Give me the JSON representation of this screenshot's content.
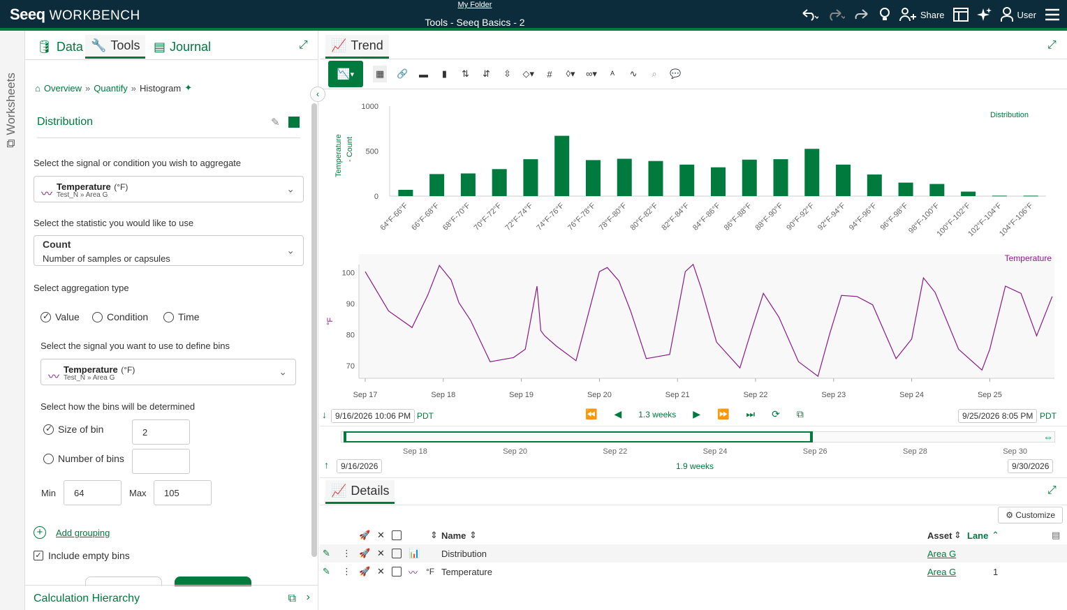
{
  "app": {
    "logo": "Seeq",
    "product": "WORKBENCH",
    "folder": "My Folder",
    "title": "Tools - Seeq Basics - 2",
    "share": "Share",
    "user": "User"
  },
  "rail": {
    "label": "Worksheets"
  },
  "tabs": [
    {
      "label": "Data"
    },
    {
      "label": "Tools"
    },
    {
      "label": "Journal"
    }
  ],
  "breadcrumb": {
    "overview": "Overview",
    "sep": "»",
    "quantify": "Quantify",
    "current": "Histogram"
  },
  "form": {
    "name": "Distribution",
    "signal_label": "Select the signal or condition you wish to aggregate",
    "signal_name": "Temperature",
    "signal_unit": "(°F)",
    "signal_asset": "Test_N » Area G",
    "stat_label": "Select the statistic you would like to use",
    "stat_name": "Count",
    "stat_desc": "Number of samples or capsules",
    "agg_label": "Select aggregation type",
    "agg_value": "Value",
    "agg_condition": "Condition",
    "agg_time": "Time",
    "bins_signal_label": "Select the signal you want to use to define bins",
    "bins_signal_name": "Temperature",
    "bins_signal_unit": "(°F)",
    "bins_signal_asset": "Test_N » Area G",
    "bins_how_label": "Select how the bins will be determined",
    "size_of_bin": "Size of bin",
    "size_value": "2",
    "number_of_bins": "Number of bins",
    "min_label": "Min",
    "min_value": "64",
    "max_label": "Max",
    "max_value": "105",
    "add_grouping": "Add grouping",
    "include_empty": "Include empty bins",
    "calc_hierarchy": "Calculation Hierarchy"
  },
  "trend": {
    "tab": "Trend",
    "start": "9/16/2026 10:06 PM",
    "tz": "PDT",
    "end": "9/25/2026 8:05 PM",
    "duration": "1.3 weeks",
    "overview_start": "9/16/2026",
    "overview_end": "9/30/2026",
    "overview_duration": "1.9 weeks",
    "overview_ticks": [
      "Sep 18",
      "Sep 20",
      "Sep 22",
      "Sep 24",
      "Sep 26",
      "Sep 28",
      "Sep 30"
    ]
  },
  "chart_data": [
    {
      "type": "bar",
      "legend": "Distribution",
      "ylabel_1": "Temperature",
      "ylabel_2": "- Count",
      "yticks": [
        "1000",
        "500",
        "0"
      ],
      "ylim": [
        0,
        1000
      ],
      "categories": [
        "64°F-66°F",
        "66°F-68°F",
        "68°F-70°F",
        "70°F-72°F",
        "72°F-74°F",
        "74°F-76°F",
        "76°F-78°F",
        "78°F-80°F",
        "80°F-82°F",
        "82°F-84°F",
        "84°F-86°F",
        "86°F-88°F",
        "88°F-90°F",
        "90°F-92°F",
        "92°F-94°F",
        "94°F-96°F",
        "96°F-98°F",
        "98°F-100°F",
        "100°F-102°F",
        "102°F-104°F",
        "104°F-106°F"
      ],
      "values": [
        70,
        245,
        252,
        300,
        410,
        670,
        400,
        415,
        390,
        350,
        320,
        405,
        410,
        525,
        350,
        240,
        150,
        135,
        50,
        5,
        5
      ],
      "color": "#007a3d"
    },
    {
      "type": "line",
      "legend": "Temperature",
      "ylabel": "°F",
      "yticks": [
        "100",
        "90",
        "80",
        "70"
      ],
      "ylim": [
        66,
        106
      ],
      "xticks": [
        "Sep 17",
        "Sep 18",
        "Sep 19",
        "Sep 20",
        "Sep 21",
        "Sep 22",
        "Sep 23",
        "Sep 24",
        "Sep 25"
      ],
      "x_days": [
        0,
        0.3,
        0.6,
        0.8,
        0.95,
        1.1,
        1.2,
        1.35,
        1.6,
        1.9,
        2.05,
        2.2,
        2.25,
        2.3,
        2.45,
        2.7,
        3.0,
        3.1,
        3.25,
        3.4,
        3.6,
        3.9,
        4.1,
        4.2,
        4.3,
        4.5,
        4.8,
        4.95,
        5.1,
        5.3,
        5.55,
        5.8,
        5.95,
        6.1,
        6.3,
        6.5,
        6.8,
        7.0,
        7.15,
        7.3,
        7.6,
        7.9,
        8.0,
        8.2,
        8.4,
        8.6,
        8.8
      ],
      "values": [
        100,
        88,
        82,
        93,
        102,
        98,
        90,
        85,
        71,
        73,
        75,
        96,
        81,
        80,
        76,
        72,
        100,
        102,
        97,
        88,
        72,
        74,
        100,
        103,
        95,
        78,
        69,
        82,
        93,
        86,
        71,
        67,
        80,
        93,
        92,
        90,
        72,
        79,
        98,
        94,
        75,
        69,
        75,
        96,
        93,
        80,
        92
      ],
      "color": "#8b1a89"
    }
  ],
  "details": {
    "tab": "Details",
    "customize": "Customize",
    "col_name": "Name",
    "col_asset": "Asset",
    "col_lane": "Lane",
    "rows": [
      {
        "name": "Distribution",
        "asset": "Area G",
        "lane": "",
        "unit": ""
      },
      {
        "name": "Temperature",
        "asset": "Area G",
        "lane": "1",
        "unit": "°F"
      }
    ]
  }
}
